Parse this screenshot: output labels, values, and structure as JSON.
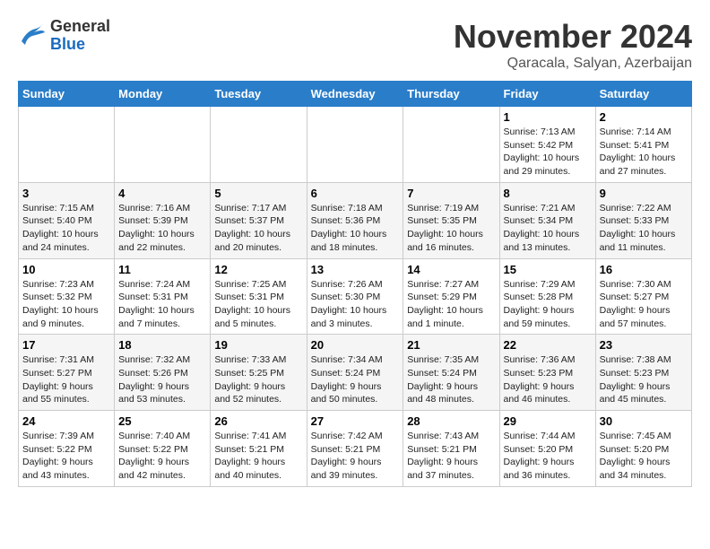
{
  "logo": {
    "line1": "General",
    "line2": "Blue"
  },
  "title": "November 2024",
  "location": "Qaracala, Salyan, Azerbaijan",
  "weekdays": [
    "Sunday",
    "Monday",
    "Tuesday",
    "Wednesday",
    "Thursday",
    "Friday",
    "Saturday"
  ],
  "weeks": [
    [
      null,
      null,
      null,
      null,
      null,
      {
        "day": "1",
        "sunrise": "Sunrise: 7:13 AM",
        "sunset": "Sunset: 5:42 PM",
        "daylight": "Daylight: 10 hours and 29 minutes."
      },
      {
        "day": "2",
        "sunrise": "Sunrise: 7:14 AM",
        "sunset": "Sunset: 5:41 PM",
        "daylight": "Daylight: 10 hours and 27 minutes."
      }
    ],
    [
      {
        "day": "3",
        "sunrise": "Sunrise: 7:15 AM",
        "sunset": "Sunset: 5:40 PM",
        "daylight": "Daylight: 10 hours and 24 minutes."
      },
      {
        "day": "4",
        "sunrise": "Sunrise: 7:16 AM",
        "sunset": "Sunset: 5:39 PM",
        "daylight": "Daylight: 10 hours and 22 minutes."
      },
      {
        "day": "5",
        "sunrise": "Sunrise: 7:17 AM",
        "sunset": "Sunset: 5:37 PM",
        "daylight": "Daylight: 10 hours and 20 minutes."
      },
      {
        "day": "6",
        "sunrise": "Sunrise: 7:18 AM",
        "sunset": "Sunset: 5:36 PM",
        "daylight": "Daylight: 10 hours and 18 minutes."
      },
      {
        "day": "7",
        "sunrise": "Sunrise: 7:19 AM",
        "sunset": "Sunset: 5:35 PM",
        "daylight": "Daylight: 10 hours and 16 minutes."
      },
      {
        "day": "8",
        "sunrise": "Sunrise: 7:21 AM",
        "sunset": "Sunset: 5:34 PM",
        "daylight": "Daylight: 10 hours and 13 minutes."
      },
      {
        "day": "9",
        "sunrise": "Sunrise: 7:22 AM",
        "sunset": "Sunset: 5:33 PM",
        "daylight": "Daylight: 10 hours and 11 minutes."
      }
    ],
    [
      {
        "day": "10",
        "sunrise": "Sunrise: 7:23 AM",
        "sunset": "Sunset: 5:32 PM",
        "daylight": "Daylight: 10 hours and 9 minutes."
      },
      {
        "day": "11",
        "sunrise": "Sunrise: 7:24 AM",
        "sunset": "Sunset: 5:31 PM",
        "daylight": "Daylight: 10 hours and 7 minutes."
      },
      {
        "day": "12",
        "sunrise": "Sunrise: 7:25 AM",
        "sunset": "Sunset: 5:31 PM",
        "daylight": "Daylight: 10 hours and 5 minutes."
      },
      {
        "day": "13",
        "sunrise": "Sunrise: 7:26 AM",
        "sunset": "Sunset: 5:30 PM",
        "daylight": "Daylight: 10 hours and 3 minutes."
      },
      {
        "day": "14",
        "sunrise": "Sunrise: 7:27 AM",
        "sunset": "Sunset: 5:29 PM",
        "daylight": "Daylight: 10 hours and 1 minute."
      },
      {
        "day": "15",
        "sunrise": "Sunrise: 7:29 AM",
        "sunset": "Sunset: 5:28 PM",
        "daylight": "Daylight: 9 hours and 59 minutes."
      },
      {
        "day": "16",
        "sunrise": "Sunrise: 7:30 AM",
        "sunset": "Sunset: 5:27 PM",
        "daylight": "Daylight: 9 hours and 57 minutes."
      }
    ],
    [
      {
        "day": "17",
        "sunrise": "Sunrise: 7:31 AM",
        "sunset": "Sunset: 5:27 PM",
        "daylight": "Daylight: 9 hours and 55 minutes."
      },
      {
        "day": "18",
        "sunrise": "Sunrise: 7:32 AM",
        "sunset": "Sunset: 5:26 PM",
        "daylight": "Daylight: 9 hours and 53 minutes."
      },
      {
        "day": "19",
        "sunrise": "Sunrise: 7:33 AM",
        "sunset": "Sunset: 5:25 PM",
        "daylight": "Daylight: 9 hours and 52 minutes."
      },
      {
        "day": "20",
        "sunrise": "Sunrise: 7:34 AM",
        "sunset": "Sunset: 5:24 PM",
        "daylight": "Daylight: 9 hours and 50 minutes."
      },
      {
        "day": "21",
        "sunrise": "Sunrise: 7:35 AM",
        "sunset": "Sunset: 5:24 PM",
        "daylight": "Daylight: 9 hours and 48 minutes."
      },
      {
        "day": "22",
        "sunrise": "Sunrise: 7:36 AM",
        "sunset": "Sunset: 5:23 PM",
        "daylight": "Daylight: 9 hours and 46 minutes."
      },
      {
        "day": "23",
        "sunrise": "Sunrise: 7:38 AM",
        "sunset": "Sunset: 5:23 PM",
        "daylight": "Daylight: 9 hours and 45 minutes."
      }
    ],
    [
      {
        "day": "24",
        "sunrise": "Sunrise: 7:39 AM",
        "sunset": "Sunset: 5:22 PM",
        "daylight": "Daylight: 9 hours and 43 minutes."
      },
      {
        "day": "25",
        "sunrise": "Sunrise: 7:40 AM",
        "sunset": "Sunset: 5:22 PM",
        "daylight": "Daylight: 9 hours and 42 minutes."
      },
      {
        "day": "26",
        "sunrise": "Sunrise: 7:41 AM",
        "sunset": "Sunset: 5:21 PM",
        "daylight": "Daylight: 9 hours and 40 minutes."
      },
      {
        "day": "27",
        "sunrise": "Sunrise: 7:42 AM",
        "sunset": "Sunset: 5:21 PM",
        "daylight": "Daylight: 9 hours and 39 minutes."
      },
      {
        "day": "28",
        "sunrise": "Sunrise: 7:43 AM",
        "sunset": "Sunset: 5:21 PM",
        "daylight": "Daylight: 9 hours and 37 minutes."
      },
      {
        "day": "29",
        "sunrise": "Sunrise: 7:44 AM",
        "sunset": "Sunset: 5:20 PM",
        "daylight": "Daylight: 9 hours and 36 minutes."
      },
      {
        "day": "30",
        "sunrise": "Sunrise: 7:45 AM",
        "sunset": "Sunset: 5:20 PM",
        "daylight": "Daylight: 9 hours and 34 minutes."
      }
    ]
  ]
}
